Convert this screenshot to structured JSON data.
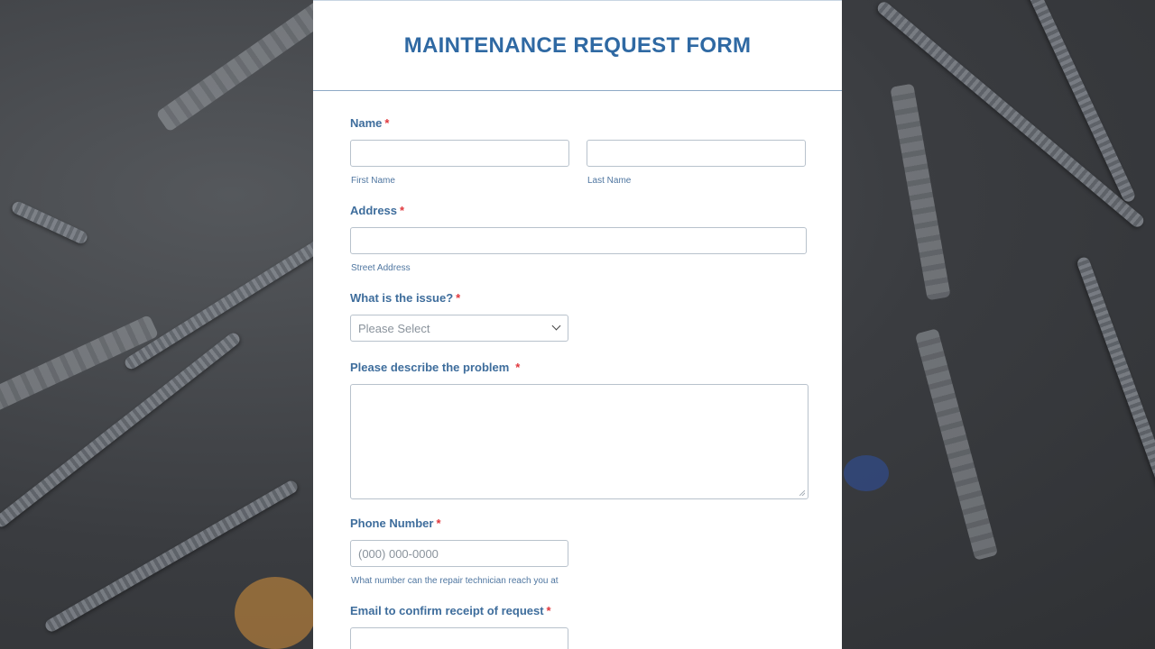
{
  "form": {
    "title": "MAINTENANCE REQUEST FORM",
    "required_mark": "*",
    "name": {
      "label": "Name",
      "first_sublabel": "First Name",
      "last_sublabel": "Last Name",
      "first_value": "",
      "last_value": ""
    },
    "address": {
      "label": "Address",
      "street_sublabel": "Street Address",
      "value": ""
    },
    "issue": {
      "label": "What is the issue?",
      "selected": "Please Select"
    },
    "problem": {
      "label": "Please describe the problem",
      "value": ""
    },
    "phone": {
      "label": "Phone Number",
      "placeholder": "(000) 000-0000",
      "sublabel": "What number can the repair technician reach you at"
    },
    "email": {
      "label": "Email to confirm receipt of request",
      "value": ""
    }
  },
  "colors": {
    "title": "#2f69a3",
    "label": "#3e6d9c",
    "required": "#e0373c",
    "background": "#3b3d40"
  },
  "icons": {
    "select_arrow": "chevron-down-icon",
    "resize_handle": "resize-grip-icon"
  }
}
